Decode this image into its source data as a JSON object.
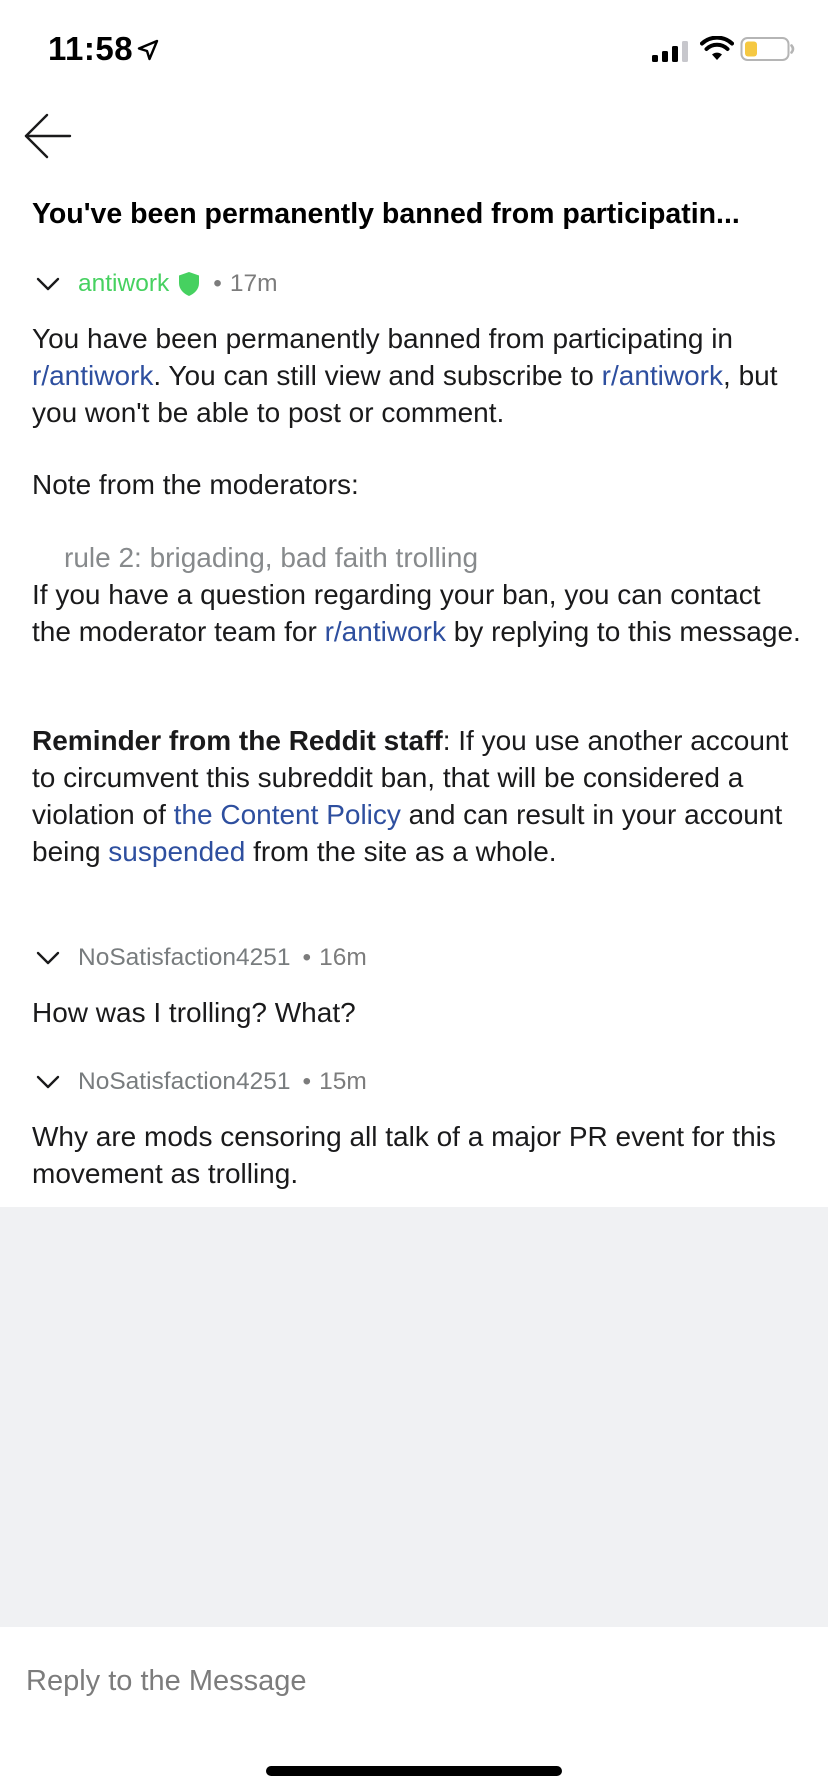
{
  "status_bar": {
    "time": "11:58",
    "battery_level": 0.3,
    "battery_color": "#f5c842"
  },
  "message_subject": "You've been permanently banned from participatin...",
  "messages": [
    {
      "author": "antiwork",
      "is_moderator": true,
      "age": "17m",
      "body": {
        "p1_a": "You have been permanently banned from participating in ",
        "p1_link1": "r/antiwork",
        "p1_b": ". You can still view and subscribe to ",
        "p1_link2": "r/antiwork",
        "p1_c": ", but you won't be able to post or comment.",
        "note_label": "Note from the moderators:",
        "quote": "rule 2: brigading, bad faith trolling",
        "p3_a": "If you have a question regarding your ban, you can contact the moderator team for ",
        "p3_link": "r/antiwork",
        "p3_b": " by replying to this message.",
        "p4_bold": "Reminder from the Reddit staff",
        "p4_a": ": If you use another account to circumvent this subreddit ban, that will be considered a violation of ",
        "p4_link1": "the Content Policy",
        "p4_b": " and can result in your account being ",
        "p4_link2": "suspended",
        "p4_c": " from the site as a whole."
      }
    },
    {
      "author": "NoSatisfaction4251",
      "is_moderator": false,
      "age": "16m",
      "text": "How was I trolling? What?"
    },
    {
      "author": "NoSatisfaction4251",
      "is_moderator": false,
      "age": "15m",
      "text": "Why are mods censoring all talk of a major PR event for this movement as trolling."
    }
  ],
  "separator": "•",
  "reply": {
    "placeholder": "Reply to the Message"
  },
  "colors": {
    "mod_green": "#46d160",
    "link_blue": "#2e4f9f",
    "background_grey": "#f0f1f3"
  },
  "icons": [
    "location-arrow-icon",
    "cellular-signal-icon",
    "wifi-icon",
    "battery-icon",
    "back-arrow-icon",
    "chevron-down-icon",
    "mod-shield-icon"
  ]
}
